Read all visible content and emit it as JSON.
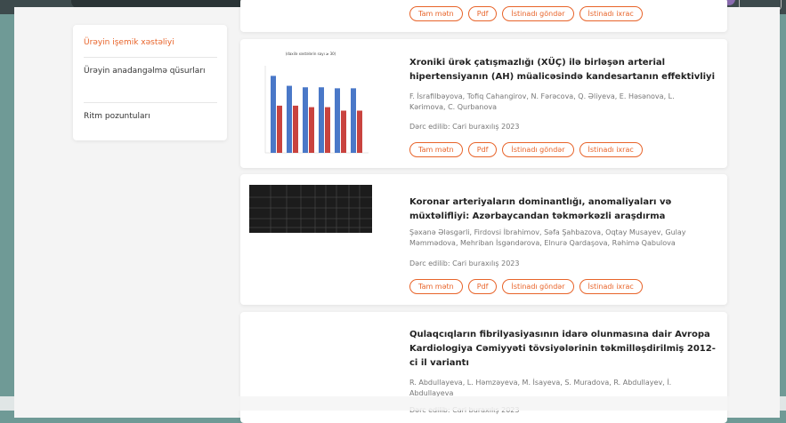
{
  "sidebar": {
    "items": [
      {
        "label": "Ürəyin işemik xəstəliyi",
        "active": true
      },
      {
        "label": "Ürəyin anadangəlmə qüsurları",
        "active": false
      },
      {
        "label": "Ritm pozuntuları",
        "active": false
      }
    ]
  },
  "buttons": {
    "full_text": "Tam mətn",
    "pdf": "Pdf",
    "send_citation": "İstinadı göndər",
    "export_citation": "İstinadı ixrac"
  },
  "articles": [
    {
      "title": "Xroniki ürək çatışmazlığı (XÜÇ) ilə birləşən arterial hipertensiyanın (AH) müalicəsində kandesartanın effektivliyi",
      "authors": "F. İsrafilbəyova, Tofiq Cahangirov, N. Fərəcova, Q. Əliyeva, E. Həsənova, L. Kərimova, C. Qurbanova",
      "date": "Dərc edilib: Cari buraxılış 2023",
      "thumb_type": "bar-chart"
    },
    {
      "title": "Koronar arteriyaların dominantlığı, anomaliyaları və müxtəlifliyi: Azərbaycandan təkmərkəzli araşdırma",
      "authors": "Şəxanə Ələsgərli, Firdovsi İbrahimov, Səfa Şahbazova, Oqtay Musayev, Gulay Məmmədova, Mehriban İsgəndərova, Elnurə Qardaşova, Rəhimə Qabulova",
      "date": "Dərc edilib: Cari buraxılış 2023",
      "thumb_type": "dark-table"
    },
    {
      "title": "Qulaqcıqların fibrilyasiyasının idarə olunmasına dair Avropa Kardiologiya Cəmiyyəti tövsiyələrinin təkmilləşdirilmiş 2012-ci il variantı",
      "authors": "R. Abdullayeva, L. Həmzəyeva, M. İsayeva, S. Muradova, R. Abdullayev, İ. Abdullayeva",
      "date": "Dərc edilib: Cari buraxılış 2023",
      "thumb_type": "blank"
    }
  ],
  "thumb_chart": {
    "title": "(daxilə xəstələrin sayı ≥ 30)",
    "values": [
      {
        "blue": 155,
        "red": 95
      },
      {
        "blue": 135,
        "red": 95
      },
      {
        "blue": 132,
        "red": 92
      },
      {
        "blue": 132,
        "red": 92
      },
      {
        "blue": 130,
        "red": 85
      },
      {
        "blue": 130,
        "red": 85
      }
    ]
  }
}
